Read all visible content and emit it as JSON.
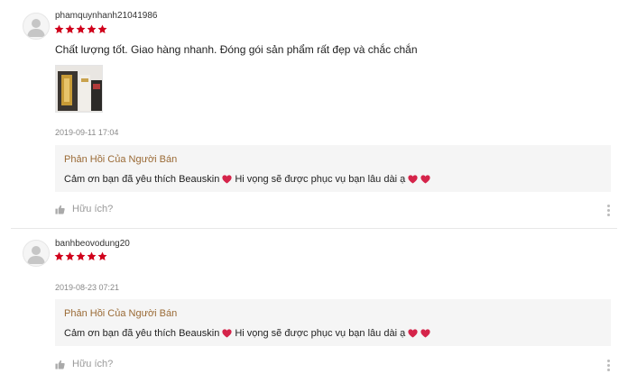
{
  "colors": {
    "star": "#d0011b",
    "heart": "#d5244a",
    "seller_title": "#9a6a35",
    "reply_bg": "#f5f5f5"
  },
  "reviews": [
    {
      "username": "phamquynhanh21041986",
      "rating": 5,
      "comment": "Chất lượng tốt. Giao hàng nhanh. Đóng gói sản phẩm rất đẹp và chắc chắn",
      "has_image": true,
      "timestamp": "2019-09-11 17:04",
      "seller_reply": {
        "title": "Phản Hồi Của Người Bán",
        "text_part1": "Cảm ơn bạn đã yêu thích Beauskin",
        "text_part2": "Hi vọng sẽ được phục vụ bạn lâu dài ạ"
      },
      "helpful_label": "Hữu ích?"
    },
    {
      "username": "banhbeovodung20",
      "rating": 5,
      "comment": "",
      "has_image": false,
      "timestamp": "2019-08-23 07:21",
      "seller_reply": {
        "title": "Phản Hồi Của Người Bán",
        "text_part1": "Cảm ơn bạn đã yêu thích Beauskin",
        "text_part2": "Hi vọng sẽ được phục vụ bạn lâu dài ạ"
      },
      "helpful_label": "Hữu ích?"
    }
  ],
  "icons": {
    "avatar": "user-silhouette-icon",
    "star": "star-icon",
    "heart": "heart-icon",
    "like": "thumbs-up-icon",
    "more": "more-vertical-icon"
  }
}
